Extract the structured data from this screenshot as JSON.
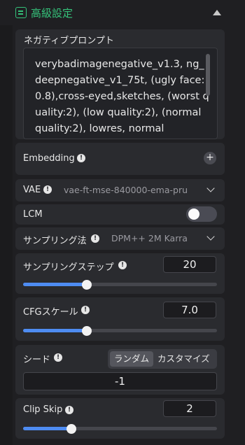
{
  "section": {
    "title": "高級設定",
    "icon": "settings-panel-icon",
    "collapse_icon": "caret-up-icon",
    "accent": "#35c27a"
  },
  "negative_prompt": {
    "label": "ネガティブプロンプト",
    "value": "verybadimagenegative_v1.3, ng_deepnegative_v1_75t, (ugly face:0.8),cross-eyed,sketches, (worst quality:2), (low quality:2), (normal quality:2), lowres, normal"
  },
  "embedding": {
    "label": "Embedding",
    "add_icon": "plus-circle-icon"
  },
  "vae": {
    "label": "VAE",
    "value": "vae-ft-mse-840000-ema-pru"
  },
  "lcm": {
    "label": "LCM",
    "enabled": false
  },
  "sampler": {
    "label": "サンプリング法",
    "value": "DPM++ 2M Karra"
  },
  "steps": {
    "label": "サンプリングステップ",
    "value": "20",
    "fraction": 0.33
  },
  "cfg": {
    "label": "CFGスケール",
    "value": "7.0",
    "fraction": 0.33
  },
  "seed": {
    "label": "シード",
    "options": [
      "ランダム",
      "カスタマイズ"
    ],
    "selected": "ランダム",
    "value": "-1"
  },
  "clip_skip": {
    "label": "Clip Skip",
    "value": "2",
    "fraction": 0.25
  },
  "colors": {
    "slider_fill": "#4e8cf2",
    "panel_bg": "#2a2b2f",
    "page_bg": "#1f1f22"
  }
}
